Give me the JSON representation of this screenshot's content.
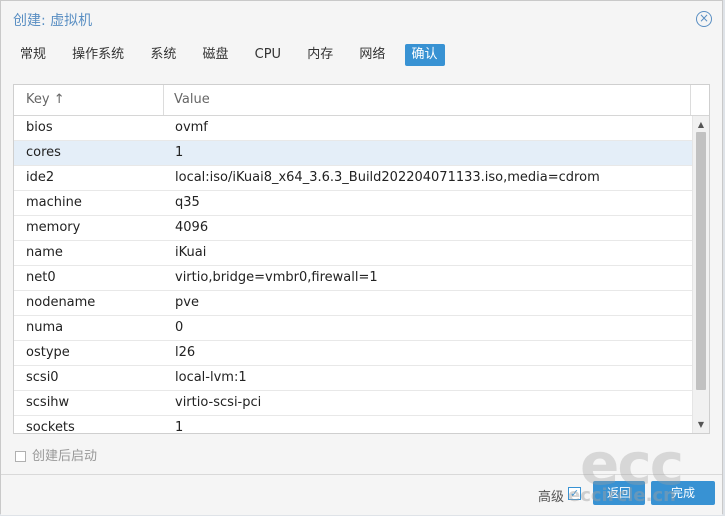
{
  "dialog": {
    "title": "创建: 虚拟机",
    "close_glyph": "×"
  },
  "tabs": [
    {
      "label": "常规",
      "active": false
    },
    {
      "label": "操作系统",
      "active": false
    },
    {
      "label": "系统",
      "active": false
    },
    {
      "label": "磁盘",
      "active": false
    },
    {
      "label": "CPU",
      "active": false
    },
    {
      "label": "内存",
      "active": false
    },
    {
      "label": "网络",
      "active": false
    },
    {
      "label": "确认",
      "active": true
    }
  ],
  "grid": {
    "columns": [
      "Key ↑",
      "Value"
    ],
    "rows": [
      {
        "key": "bios",
        "value": "ovmf"
      },
      {
        "key": "cores",
        "value": "1",
        "selected": true
      },
      {
        "key": "ide2",
        "value": "local:iso/iKuai8_x64_3.6.3_Build202204071133.iso,media=cdrom"
      },
      {
        "key": "machine",
        "value": "q35"
      },
      {
        "key": "memory",
        "value": "4096"
      },
      {
        "key": "name",
        "value": "iKuai"
      },
      {
        "key": "net0",
        "value": "virtio,bridge=vmbr0,firewall=1"
      },
      {
        "key": "nodename",
        "value": "pve"
      },
      {
        "key": "numa",
        "value": "0"
      },
      {
        "key": "ostype",
        "value": "l26"
      },
      {
        "key": "scsi0",
        "value": "local-lvm:1"
      },
      {
        "key": "scsihw",
        "value": "virtio-scsi-pci"
      },
      {
        "key": "sockets",
        "value": "1"
      }
    ]
  },
  "autostart": {
    "label": "创建后启动",
    "checked": false
  },
  "footer": {
    "advanced_label": "高级",
    "advanced_checked": true,
    "back_label": "返回",
    "finish_label": "完成"
  },
  "watermark": {
    "main": "ecc",
    "sub": "eccircle.cn"
  },
  "colors": {
    "accent": "#3892d3",
    "title": "#5a8fc3",
    "selected_row": "#e4eef8"
  }
}
